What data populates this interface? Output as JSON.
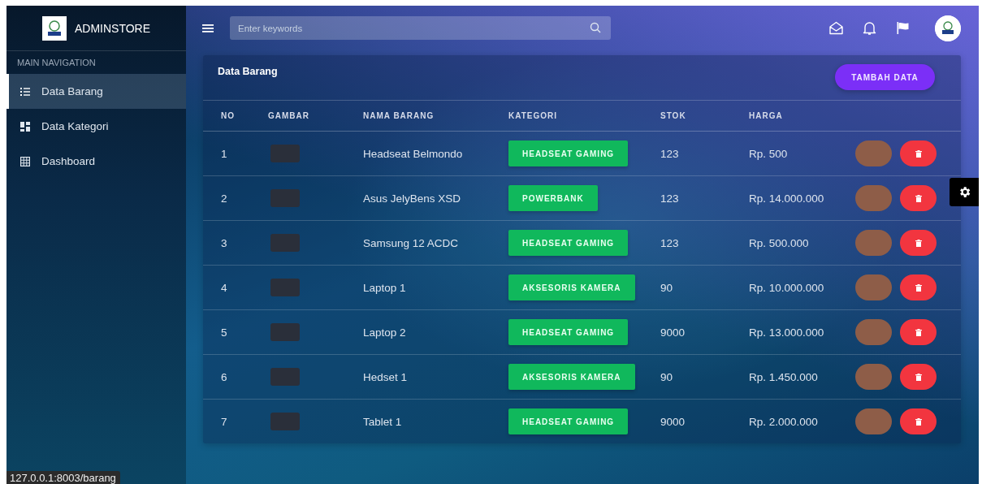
{
  "brand": {
    "name": "ADMINSTORE"
  },
  "sidebar": {
    "heading": "MAIN NAVIGATION",
    "items": [
      {
        "label": "Data Barang",
        "selected": true
      },
      {
        "label": "Data Kategori",
        "selected": false
      },
      {
        "label": "Dashboard",
        "selected": false
      }
    ]
  },
  "topbar": {
    "search": {
      "placeholder": "Enter keywords"
    }
  },
  "card": {
    "title": "Data Barang",
    "add_button": "TAMBAH DATA",
    "table": {
      "columns": [
        "NO",
        "GAMBAR",
        "NAMA BARANG",
        "KATEGORI",
        "STOK",
        "HARGA"
      ],
      "rows": [
        {
          "no": "1",
          "name": "Headseat Belmondo",
          "category": "HEADSEAT GAMING",
          "stock": "123",
          "price": "Rp. 500"
        },
        {
          "no": "2",
          "name": "Asus JelyBens XSD",
          "category": "POWERBANK",
          "stock": "123",
          "price": "Rp. 14.000.000"
        },
        {
          "no": "3",
          "name": "Samsung 12 ACDC",
          "category": "HEADSEAT GAMING",
          "stock": "123",
          "price": "Rp. 500.000"
        },
        {
          "no": "4",
          "name": "Laptop 1",
          "category": "AKSESORIS KAMERA",
          "stock": "90",
          "price": "Rp. 10.000.000"
        },
        {
          "no": "5",
          "name": "Laptop 2",
          "category": "HEADSEAT GAMING",
          "stock": "9000",
          "price": "Rp. 13.000.000"
        },
        {
          "no": "6",
          "name": "Hedset 1",
          "category": "AKSESORIS KAMERA",
          "stock": "90",
          "price": "Rp. 1.450.000"
        },
        {
          "no": "7",
          "name": "Tablet 1",
          "category": "HEADSEAT GAMING",
          "stock": "9000",
          "price": "Rp. 2.000.000"
        }
      ]
    }
  },
  "status_bar": {
    "url": "127.0.0.1:8003/barang"
  }
}
